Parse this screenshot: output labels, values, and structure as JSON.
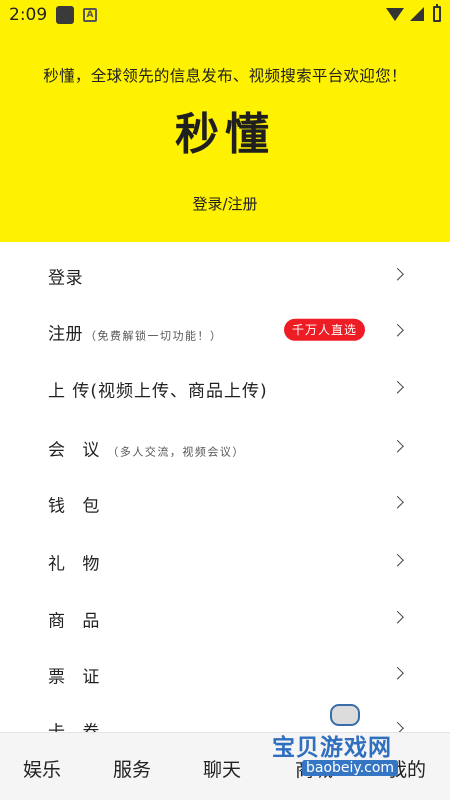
{
  "status_bar": {
    "time": "2:09",
    "a_icon_text": "A",
    "icons": [
      "app-icon",
      "a-icon",
      "wifi-icon",
      "signal-icon",
      "battery-icon"
    ]
  },
  "header": {
    "background_color": "#fff200",
    "welcome_text": "秒懂，全球领先的信息发布、视频搜索平台欢迎您！",
    "logo_text": "秒懂",
    "login_link": "登录/注册"
  },
  "menu": {
    "items": [
      {
        "label": "登录",
        "note": "",
        "badge": ""
      },
      {
        "label": "注册",
        "note": "（免费解锁一切功能！）",
        "badge": "千万人直选"
      },
      {
        "label": "上 传(视频上传、商品上传)",
        "note": "",
        "badge": ""
      },
      {
        "label": "会 议",
        "note": "（多人交流，视频会议）",
        "badge": ""
      },
      {
        "label": "钱 包",
        "note": "",
        "badge": ""
      },
      {
        "label": "礼 物",
        "note": "",
        "badge": ""
      },
      {
        "label": "商 品",
        "note": "",
        "badge": ""
      },
      {
        "label": "票 证",
        "note": "",
        "badge": ""
      },
      {
        "label": "卡 券",
        "note": "",
        "badge": ""
      }
    ],
    "badge_color": "#ee1c24"
  },
  "tabbar": {
    "tabs": [
      "娱乐",
      "服务",
      "聊天",
      "商城",
      "我的"
    ]
  },
  "watermark": {
    "title": "宝贝游戏网",
    "url": "baobeiy.com"
  }
}
